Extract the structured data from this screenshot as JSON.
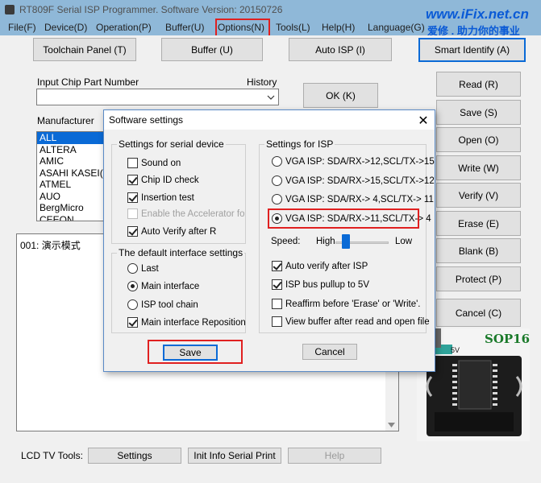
{
  "window": {
    "title": "RT809F Serial ISP Programmer. Software Version: 20150726",
    "watermark_url": "www.iFix.net.cn",
    "watermark_slogan": "爱修 . 助力你的事业"
  },
  "menu": [
    "File(F)",
    "Device(D)",
    "Operation(P)",
    "Buffer(U)",
    "Options(N)",
    "Tools(L)",
    "Help(H)",
    "Language(G)"
  ],
  "toolbar": {
    "toolchain": "Toolchain Panel (T)",
    "buffer": "Buffer (U)",
    "auto_isp": "Auto ISP (I)",
    "smart_identify": "Smart Identify (A)"
  },
  "chip_input": {
    "label": "Input Chip Part Number",
    "history": "History",
    "value": "",
    "ok": "OK (K)"
  },
  "manufacturer": {
    "label": "Manufacturer",
    "items": [
      "ALL",
      "ALTERA",
      "AMIC",
      "ASAHI KASEI(A",
      "ATMEL",
      "AUO",
      "BergMicro",
      "CEEON"
    ]
  },
  "log": {
    "line1": "001:  演示模式"
  },
  "side_buttons": [
    "Read (R)",
    "Save (S)",
    "Open (O)",
    "Write  (W)",
    "Verify (V)",
    "Erase (E)",
    "Blank (B)",
    "Protect (P)",
    "Cancel (C)"
  ],
  "chip_image": {
    "label": "SOP16",
    "pin_label": "5V"
  },
  "bottom": {
    "label": "LCD TV Tools:",
    "settings": "Settings",
    "init_info": "Init Info Serial Print",
    "help": "Help"
  },
  "dialog": {
    "title": "Software settings",
    "close": "✕",
    "serial_group": {
      "title": "Settings for serial device",
      "items": [
        {
          "label": "Sound on",
          "checked": false
        },
        {
          "label": "Chip ID check",
          "checked": true
        },
        {
          "label": "Insertion test",
          "checked": true
        },
        {
          "label": "Enable the Accelerator for S",
          "checked": false,
          "disabled": true
        },
        {
          "label": "Auto Verify after R",
          "checked": true
        }
      ]
    },
    "interface_group": {
      "title": "The default interface settings",
      "items": [
        {
          "label": "Last",
          "selected": false
        },
        {
          "label": "Main interface",
          "selected": true
        },
        {
          "label": "ISP tool chain",
          "selected": false
        }
      ],
      "reposition": {
        "label": "Main interface Reposition",
        "checked": true
      }
    },
    "isp_group": {
      "title": "Settings for ISP",
      "vga": [
        {
          "label": "VGA ISP: SDA/RX->12,SCL/TX->15",
          "selected": false
        },
        {
          "label": "VGA ISP: SDA/RX->15,SCL/TX->12",
          "selected": false
        },
        {
          "label": "VGA ISP: SDA/RX-> 4,SCL/TX-> 11",
          "selected": false
        },
        {
          "label": "VGA ISP: SDA/RX->11,SCL/TX->  4",
          "selected": true
        }
      ],
      "speed": {
        "label": "Speed:",
        "high": "High",
        "low": "Low",
        "level": 0.15
      },
      "checks": [
        {
          "label": "Auto verify after ISP",
          "checked": true
        },
        {
          "label": "ISP bus pullup to 5V",
          "checked": true
        },
        {
          "label": "Reaffirm before 'Erase' or 'Write'.",
          "checked": false
        },
        {
          "label": "View buffer after read and open file",
          "checked": false
        }
      ]
    },
    "save": "Save",
    "cancel": "Cancel"
  },
  "colors": {
    "background": "#8fb8d8",
    "accent": "#0a6ad6",
    "highlight": "#e02020"
  }
}
